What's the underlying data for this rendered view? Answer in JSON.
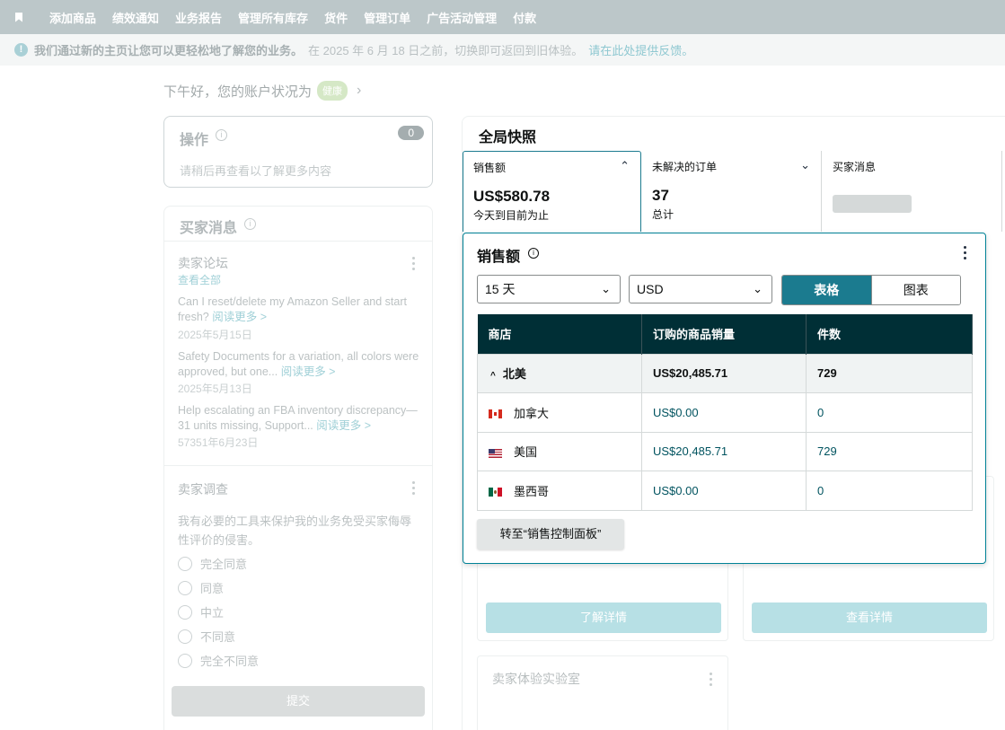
{
  "nav": {
    "items": [
      "添加商品",
      "绩效通知",
      "业务报告",
      "管理所有库存",
      "货件",
      "管理订单",
      "广告活动管理",
      "付款"
    ]
  },
  "banner": {
    "bold": "我们通过新的主页让您可以更轻松地了解您的业务。",
    "normal": "在 2025 年 6 月 18 日之前，切换即可返回到旧体验。",
    "link": "请在此处提供反馈。"
  },
  "greeting": {
    "text": "下午好，您的账户状况为",
    "badge": "健康"
  },
  "actions": {
    "title": "操作",
    "count": "0",
    "subtitle": "请稍后再查看以了解更多内容"
  },
  "buyer_messages_panel": {
    "title": "买家消息",
    "forum": {
      "title": "卖家论坛",
      "view_all": "查看全部",
      "posts": [
        {
          "text": "Can I reset/delete my Amazon Seller and start fresh?",
          "more": "阅读更多 >",
          "date": "2025年5月15日"
        },
        {
          "text": "Safety Documents for a variation, all colors were approved, but one...",
          "more": "阅读更多 >",
          "date": "2025年5月13日"
        },
        {
          "text": "Help escalating an FBA inventory discrepancy—31 units missing, Support...",
          "more": "阅读更多 >",
          "date": "57351年6月23日"
        }
      ]
    },
    "survey": {
      "title": "卖家调查",
      "question": "我有必要的工具来保护我的业务免受买家侮辱性评价的侵害。",
      "options": [
        "完全同意",
        "同意",
        "中立",
        "不同意",
        "完全不同意"
      ],
      "submit": "提交"
    }
  },
  "snapshot": {
    "title": "全局快照",
    "tiles": [
      {
        "label": "销售额",
        "value": "US$580.78",
        "sub": "今天到目前为止"
      },
      {
        "label": "未解决的订单",
        "value": "37",
        "sub": "总计"
      },
      {
        "label": "买家消息"
      }
    ],
    "learn_more": "了解详情",
    "view_details": "查看详情",
    "lab_title": "卖家体验实验室"
  },
  "sales_popover": {
    "title": "销售额",
    "period": "15 天",
    "currency": "USD",
    "view_table": "表格",
    "view_chart": "图表",
    "columns": [
      "商店",
      "订购的商品销量",
      "件数"
    ],
    "rows": [
      {
        "store": "北美",
        "sales": "US$20,485.71",
        "units": "729"
      },
      {
        "store": "加拿大",
        "sales": "US$0.00",
        "units": "0"
      },
      {
        "store": "美国",
        "sales": "US$20,485.71",
        "units": "729"
      },
      {
        "store": "墨西哥",
        "sales": "US$0.00",
        "units": "0"
      }
    ],
    "go_button": "转至“销售控制面板”"
  },
  "colors": {
    "accent": "#1b7b8f",
    "table_header": "#002f36",
    "popover_border": "#008296",
    "link": "#007185"
  }
}
